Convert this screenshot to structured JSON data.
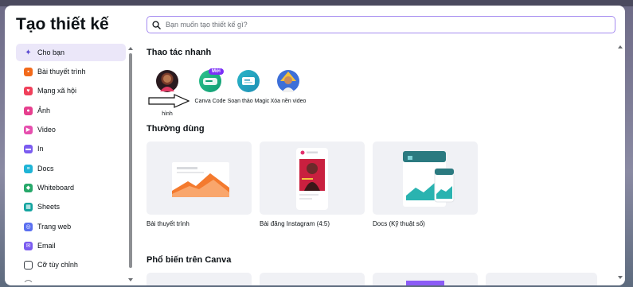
{
  "title": "Tạo thiết kế",
  "search": {
    "placeholder": "Bạn muốn tạo thiết kế gì?"
  },
  "sidebar": {
    "items": [
      {
        "label": "Cho bạn",
        "icon": "sparkle-icon",
        "color": "#5a4ad1",
        "active": true
      },
      {
        "label": "Bài thuyết trình",
        "icon": "presentation-icon",
        "color": "#f26a1b"
      },
      {
        "label": "Mạng xã hội",
        "icon": "heart-icon",
        "color": "#f0405b"
      },
      {
        "label": "Ảnh",
        "icon": "camera-icon",
        "color": "#e63f8e"
      },
      {
        "label": "Video",
        "icon": "video-icon",
        "color": "#e64fae"
      },
      {
        "label": "In",
        "icon": "printer-icon",
        "color": "#7b5cf0"
      },
      {
        "label": "Docs",
        "icon": "docs-icon",
        "color": "#1fb4d6"
      },
      {
        "label": "Whiteboard",
        "icon": "whiteboard-icon",
        "color": "#27a86a"
      },
      {
        "label": "Sheets",
        "icon": "sheets-icon",
        "color": "#13a4a0"
      },
      {
        "label": "Trang web",
        "icon": "website-icon",
        "color": "#5a6ff0"
      },
      {
        "label": "Email",
        "icon": "email-icon",
        "color": "#7b5cf0"
      },
      {
        "label": "Cỡ tùy chỉnh",
        "icon": "custom-size-icon",
        "color": "#3a3f46"
      }
    ]
  },
  "quick_actions": {
    "title": "Thao tác nhanh",
    "items": [
      {
        "label": "hình",
        "icon": "portrait-photo-icon"
      },
      {
        "label": "Canva Code",
        "icon": "canva-code-icon",
        "badge": "Mới"
      },
      {
        "label": "Soạn thảo Magic",
        "icon": "magic-write-icon"
      },
      {
        "label": "Xóa nền video",
        "icon": "video-background-remover-icon"
      }
    ]
  },
  "common": {
    "title": "Thường dùng",
    "items": [
      {
        "label": "Bài thuyết trình"
      },
      {
        "label": "Bài đăng Instagram (4:5)"
      },
      {
        "label": "Docs (Kỹ thuật số)"
      }
    ]
  },
  "popular": {
    "title": "Phổ biến trên Canva"
  },
  "colors": {
    "accent": "#7b2ff7",
    "search_border": "#a58bf0",
    "active_bg": "#ebe7f9"
  }
}
